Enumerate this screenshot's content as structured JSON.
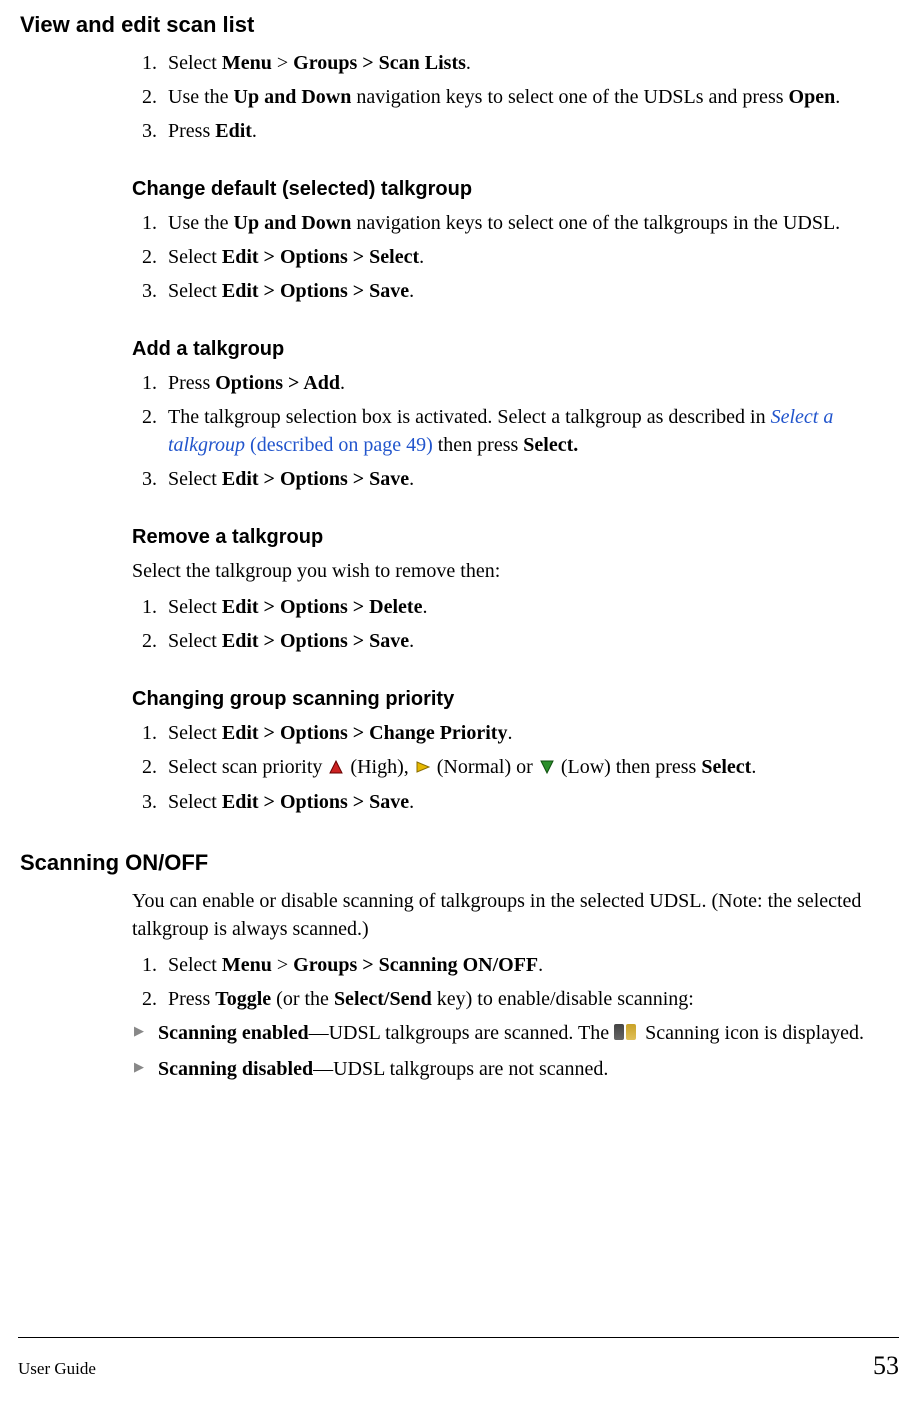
{
  "h1": "View and edit scan list",
  "s1": {
    "items": [
      {
        "pre": "Select ",
        "b1": "Menu",
        "mid1": " > ",
        "b2": "Groups > Scan Lists",
        "post": "."
      },
      {
        "pre": "Use the ",
        "b1": "Up and Down",
        "mid1": " navigation keys to select one of the UDSLs and press ",
        "b2": "Open",
        "post": "."
      },
      {
        "pre": "Press ",
        "b1": "Edit",
        "post": "."
      }
    ]
  },
  "h2": "Change default (selected) talkgroup",
  "s2": {
    "items": [
      {
        "pre": "Use the ",
        "b1": "Up and Down",
        "mid1": " navigation keys to select one of the talkgroups in the UDSL."
      },
      {
        "pre": "Select ",
        "b1": "Edit > Options > Select",
        "post": "."
      },
      {
        "pre": "Select ",
        "b1": "Edit > Options > Save",
        "post": "."
      }
    ]
  },
  "h3": "Add a talkgroup",
  "s3": {
    "items": [
      {
        "pre": "Press ",
        "b1": "Options > Add",
        "post": "."
      },
      {
        "pre": "The talkgroup selection box is activated. Select a talkgroup as described in ",
        "link_italic": "Select a talkgroup",
        "link_plain": " (described on page 49)",
        "mid1": " then press ",
        "b1": "Select."
      },
      {
        "pre": "Select ",
        "b1": "Edit > Options > Save",
        "post": "."
      }
    ]
  },
  "h4": "Remove a talkgroup",
  "p4": "Select the talkgroup you wish to remove then:",
  "s4": {
    "items": [
      {
        "pre": "Select ",
        "b1": "Edit > Options > Delete",
        "post": "."
      },
      {
        "pre": "Select ",
        "b1": "Edit > Options > Save",
        "post": "."
      }
    ]
  },
  "h5": "Changing group scanning priority",
  "s5": {
    "items": [
      {
        "pre": "Select ",
        "b1": "Edit > Options > Change Priority",
        "post": "."
      },
      {
        "pre": "Select scan priority ",
        "tri1": "high",
        "mid1": " (High), ",
        "tri2": "normal",
        "mid2": " (Normal) or ",
        "tri3": "low",
        "mid3": " (Low) then press ",
        "b1": "Select",
        "post": "."
      },
      {
        "pre": "Select ",
        "b1": "Edit > Options > Save",
        "post": "."
      }
    ]
  },
  "h6": "Scanning ON/OFF",
  "p6": "You can enable or disable scanning of talkgroups in the selected UDSL. (Note: the selected talkgroup is always scanned.)",
  "s6": {
    "items": [
      {
        "pre": "Select ",
        "b1": "Menu",
        "mid1": " > ",
        "b2": "Groups > Scanning ON/OFF",
        "post": "."
      },
      {
        "pre": "Press ",
        "b1": "Toggle",
        "mid1": " (or the ",
        "b2": "Select/Send",
        "mid2": " key) to enable/disable scanning:"
      }
    ]
  },
  "bullets6": [
    {
      "b1": "Scanning enabled",
      "mid1": "—UDSL talkgroups are scanned. The ",
      "icon": true,
      "mid2": " Scanning icon is displayed."
    },
    {
      "b1": "Scanning disabled",
      "mid1": "—UDSL talkgroups are not scanned."
    }
  ],
  "footer": {
    "left": "User Guide",
    "right": "53"
  }
}
